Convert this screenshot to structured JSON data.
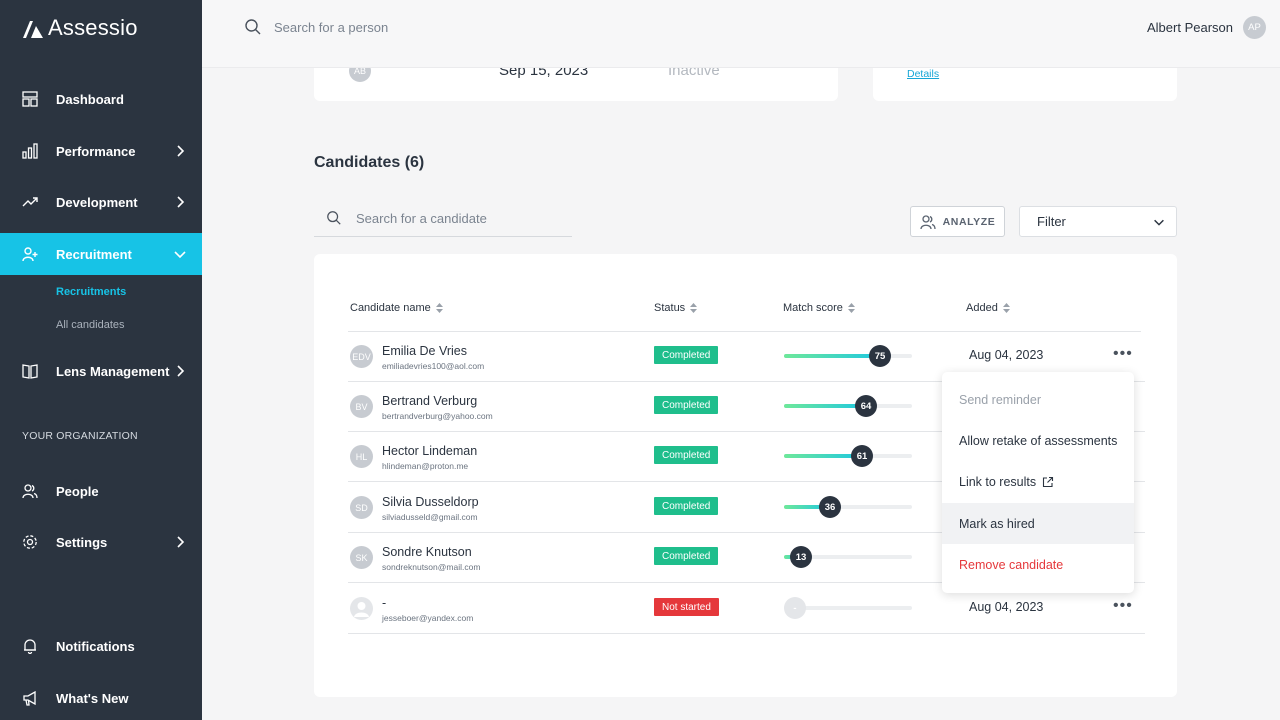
{
  "app": {
    "name": "Assessio"
  },
  "nav": {
    "dashboard": "Dashboard",
    "performance": "Performance",
    "development": "Development",
    "recruitment": "Recruitment",
    "sub_recruitments": "Recruitments",
    "sub_all_candidates": "All candidates",
    "lens_management": "Lens Management",
    "section_org": "YOUR ORGANIZATION",
    "people": "People",
    "settings": "Settings",
    "notifications": "Notifications",
    "whats_new": "What's New"
  },
  "topbar": {
    "search_placeholder": "Search for a person",
    "user_name": "Albert Pearson",
    "user_initials": "AP"
  },
  "summary": {
    "avatar_initials": "AB",
    "date": "Sep 15, 2023",
    "status": "Inactive",
    "details_link": "Details"
  },
  "candidates": {
    "title": "Candidates (6)",
    "search_placeholder": "Search for a candidate",
    "analyze_label": "ANALYZE",
    "filter_label": "Filter",
    "columns": {
      "name": "Candidate name",
      "status": "Status",
      "match": "Match score",
      "added": "Added"
    },
    "rows": [
      {
        "initials": "EDV",
        "name": "Emilia De Vries",
        "email": "emiliadevries100@aol.com",
        "status": "Completed",
        "score_label": "75",
        "score": 75,
        "added": "Aug 04, 2023"
      },
      {
        "initials": "BV",
        "name": "Bertrand Verburg",
        "email": "bertrandverburg@yahoo.com",
        "status": "Completed",
        "score_label": "64",
        "score": 64,
        "added": ""
      },
      {
        "initials": "HL",
        "name": "Hector Lindeman",
        "email": "hlindeman@proton.me",
        "status": "Completed",
        "score_label": "61",
        "score": 61,
        "added": ""
      },
      {
        "initials": "SD",
        "name": "Silvia Dusseldorp",
        "email": "silviadusseld@gmail.com",
        "status": "Completed",
        "score_label": "36",
        "score": 36,
        "added": ""
      },
      {
        "initials": "SK",
        "name": "Sondre Knutson",
        "email": "sondreknutson@mail.com",
        "status": "Completed",
        "score_label": "13",
        "score": 13,
        "added": ""
      },
      {
        "initials": "",
        "name": "-",
        "email": "jesseboer@yandex.com",
        "status": "Not started",
        "score_label": "-",
        "score": 0,
        "added": "Aug 04, 2023"
      }
    ],
    "more_glyph": "•••"
  },
  "menu": {
    "send_reminder": "Send reminder",
    "allow_retake": "Allow retake of assessments",
    "link_results": "Link to results",
    "mark_hired": "Mark as hired",
    "remove": "Remove candidate"
  },
  "colors": {
    "sidebar": "#2b3440",
    "accent": "#17c3e6",
    "completed": "#1fbe8c",
    "not_started": "#e5383b"
  }
}
